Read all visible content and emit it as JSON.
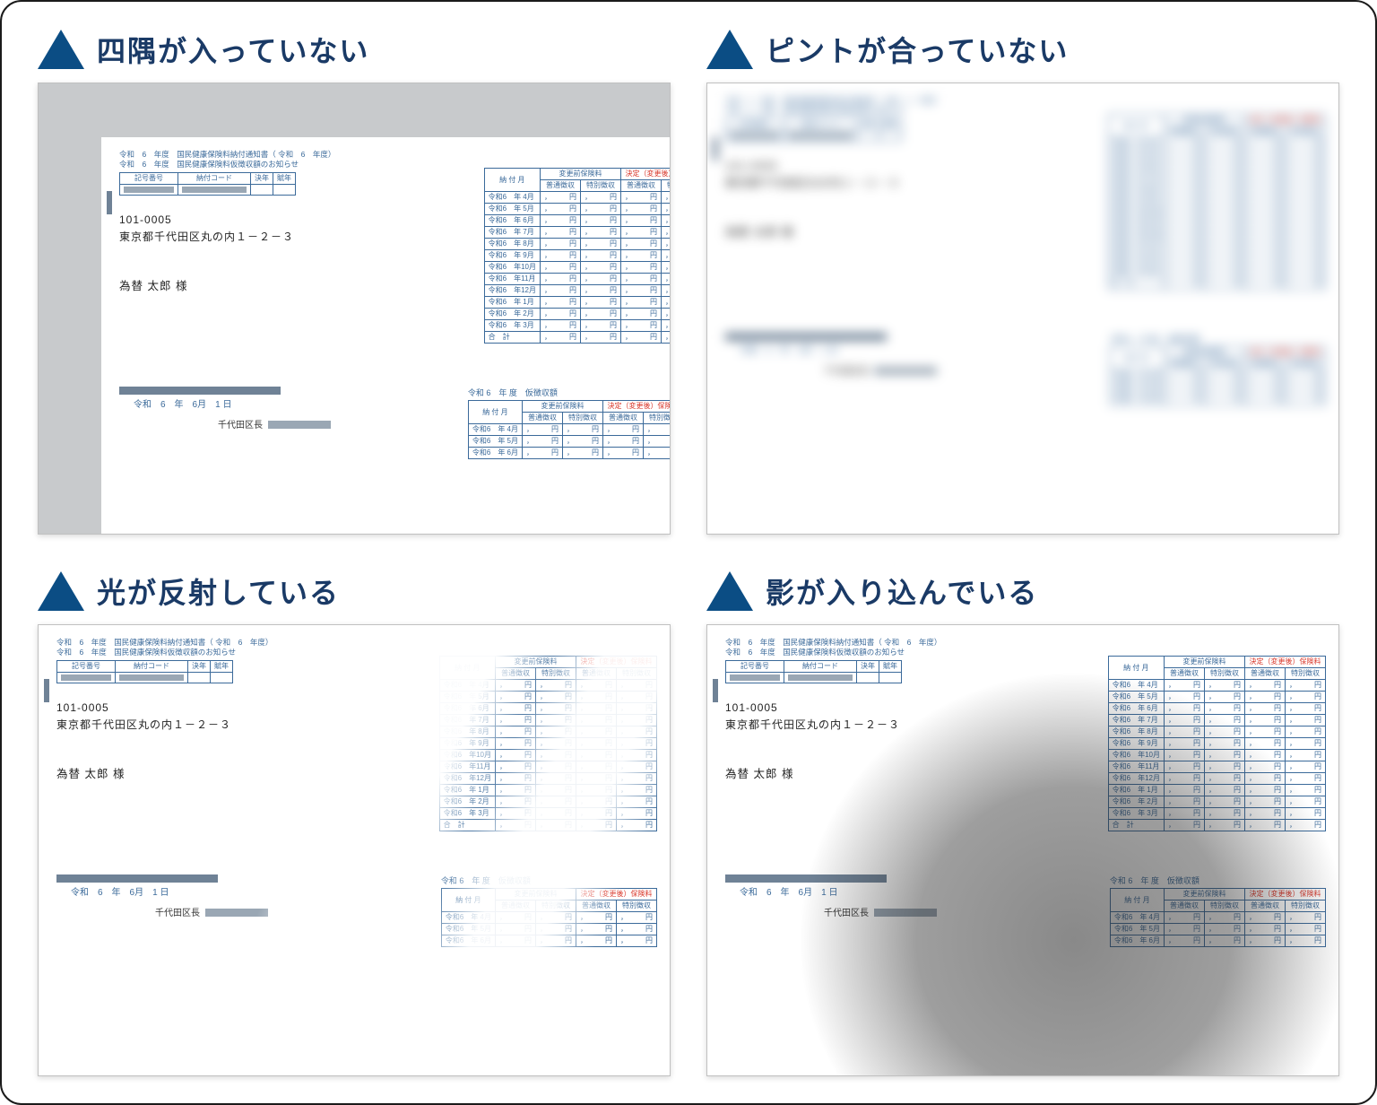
{
  "headings": {
    "corners": "四隅が入っていない",
    "focus": "ピントが合っていない",
    "glare": "光が反射している",
    "shadow": "影が入り込んでいる"
  },
  "doc": {
    "era": "令和",
    "year": "6",
    "year_label": "年度",
    "title1": "国民健康保険料納付通知書（ 令和",
    "title1_suffix": "年度）",
    "title2": "国民健康保険料仮徴収額のお知らせ",
    "code_headers": [
      "記号番号",
      "納付コード",
      "決年",
      "賦年"
    ],
    "zip": "101-0005",
    "address": "東京都千代田区丸の内１－２－３",
    "name": "為替 太郎 様",
    "pay_month_header": "納 付 月",
    "before_header": "変更前保険料",
    "after_header": "決定（変更後）保険料",
    "col_futsu": "普通徴収",
    "col_tokubetsu": "特別徴収",
    "months1": [
      "令和6　年 4月",
      "令和6　年 5月",
      "令和6　年 6月",
      "令和6　年 7月",
      "令和6　年 8月",
      "令和6　年 9月",
      "令和6　年10月",
      "令和6　年11月",
      "令和6　年12月",
      "令和6　年 1月",
      "令和6　年 2月",
      "令和6　年 3月"
    ],
    "total_label": "合　計",
    "yen": "，　　　円",
    "section2_title_prefix": "令和 6　年 度",
    "section2_title": "仮徴収額",
    "months2": [
      "令和6　年 4月",
      "令和6　年 5月",
      "令和6　年 6月"
    ],
    "footer_date": "令和　6　年　6月　1 日",
    "issuer": "千代田区長"
  }
}
